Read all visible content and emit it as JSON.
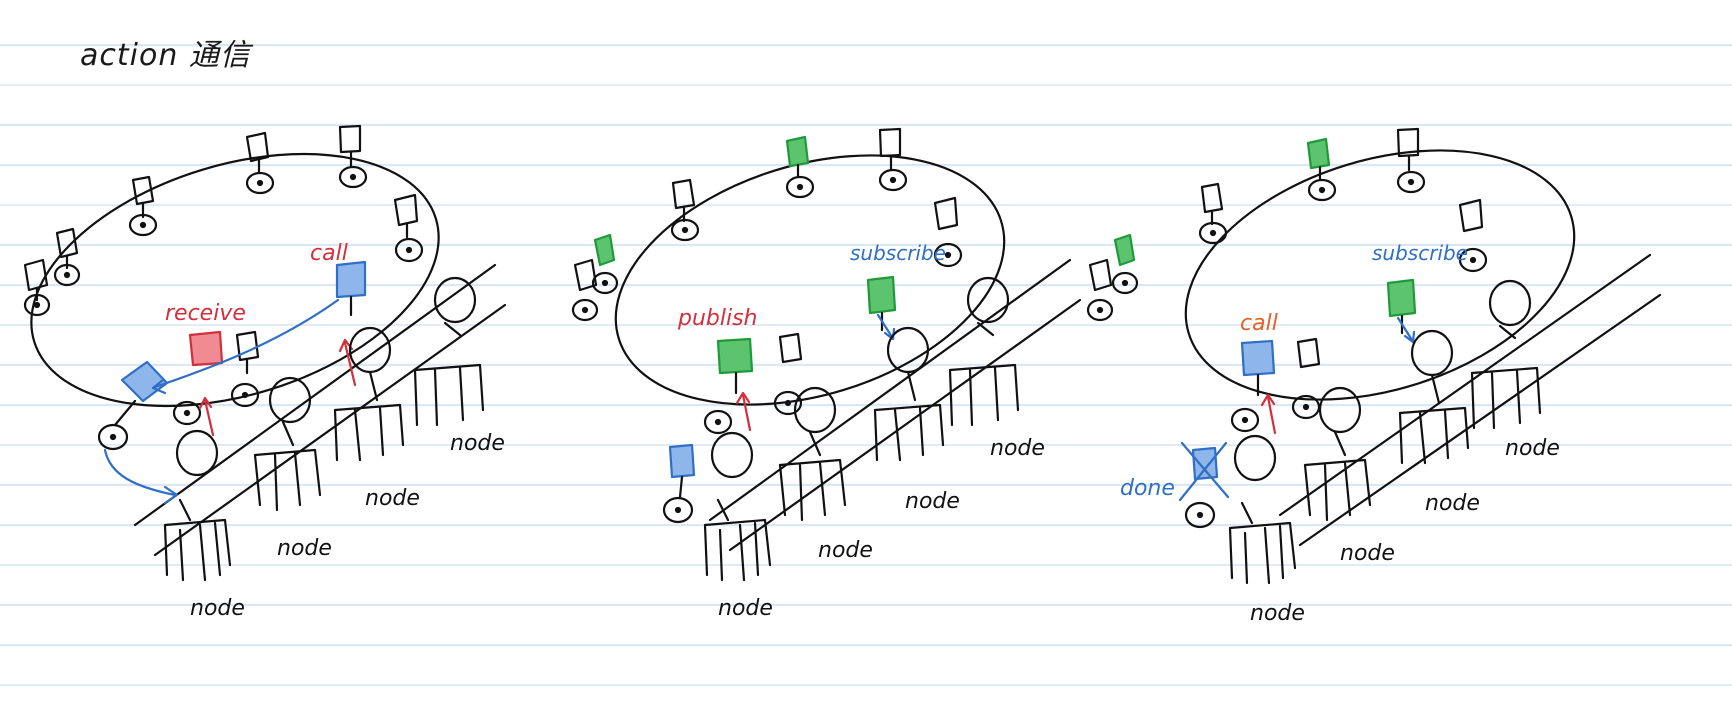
{
  "title": "action 通信",
  "colors": {
    "ink": "#111111",
    "red": "#d2303c",
    "blue": "#2f6fc6",
    "green": "#1f9a3a",
    "orange": "#e0642a"
  },
  "panels": [
    {
      "labels": {
        "top": "receive",
        "top2": "call",
        "nodes": [
          "node",
          "node",
          "node",
          "node"
        ]
      }
    },
    {
      "labels": {
        "top": "publish",
        "top2": "subscribe",
        "nodes": [
          "node",
          "node",
          "node",
          "node"
        ]
      }
    },
    {
      "labels": {
        "top": "call",
        "top2": "subscribe",
        "done": "done",
        "nodes": [
          "node",
          "node",
          "node",
          "node"
        ]
      }
    }
  ]
}
